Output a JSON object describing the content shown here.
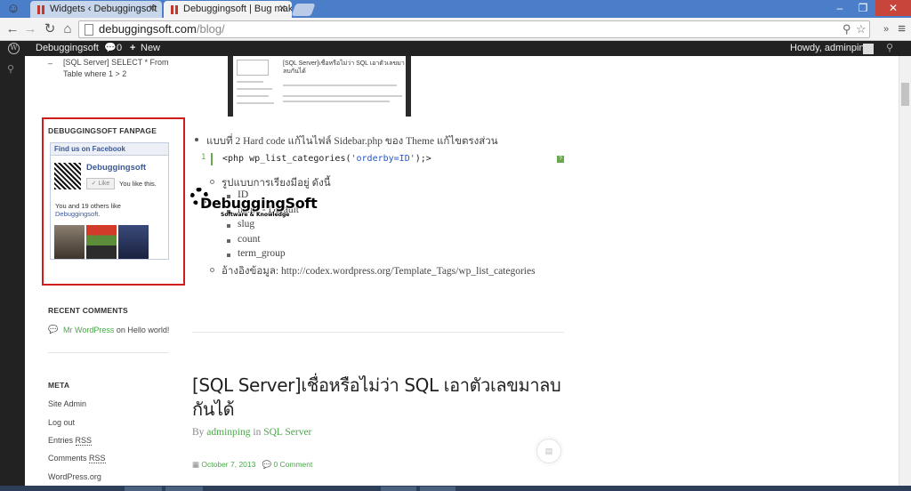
{
  "browser": {
    "tabs": [
      {
        "title": "Widgets ‹ Debuggingsoft",
        "active": false
      },
      {
        "title": "Debuggingsoft | Bug mak",
        "active": true
      }
    ],
    "url_host": "debuggingsoft.com",
    "url_path": "/blog/"
  },
  "adminbar": {
    "site": "Debuggingsoft",
    "comments_count": "0",
    "new_label": "New",
    "howdy": "Howdy, adminping"
  },
  "sidebar": {
    "top_link_line1": "[SQL Server] SELECT * From",
    "top_link_line2": "Table where 1 > 2",
    "fanpage_title": "DEBUGGINGSOFT FANPAGE",
    "fb": {
      "header": "Find us on Facebook",
      "page_name": "Debuggingsoft",
      "like_btn": "Like",
      "you_like": "You like this.",
      "others": "You and 19 others like",
      "others_link": "Debuggingsoft."
    },
    "recent_comments_title": "RECENT COMMENTS",
    "comment_author": "Mr WordPress",
    "comment_on": "on",
    "comment_post": "Hello world!",
    "meta_title": "META",
    "meta_links": [
      "Site Admin",
      "Log out",
      "Entries",
      "Comments",
      "WordPress.org"
    ],
    "rss": "RSS"
  },
  "post": {
    "shot_title": "[SQL Server]เชื่อหรือไม่ว่า SQL เอาตัวเลขมาลบกันได้",
    "method2": "แบบที่ 2 Hard code แก้ไนไฟล์ Sidebar.php ของ Theme แก้ไขตรงส่วน",
    "code_pre": "<php wp_list_categories(",
    "code_str": "'orderby=ID'",
    "code_post": ");>",
    "code_line": "1",
    "order_label": "รูปแบบการเรียงมีอยู่ ดังนี้",
    "orders": [
      "ID",
      "name - Default",
      "slug",
      "count",
      "term_group"
    ],
    "ref": "อ้างอิงข้อมูล: http://codex.wordpress.org/Template_Tags/wp_list_categories",
    "watermark": "DebuggingSoft",
    "watermark_sub": "Software & Knowledge",
    "next_title": "[SQL Server]เชื่อหรือไม่ว่า SQL เอาตัวเลขมาลบกันได้",
    "by": "By",
    "author": "adminping",
    "in": "in",
    "category": "SQL Server",
    "date": "October 7, 2013",
    "comments": "0 Comment"
  }
}
